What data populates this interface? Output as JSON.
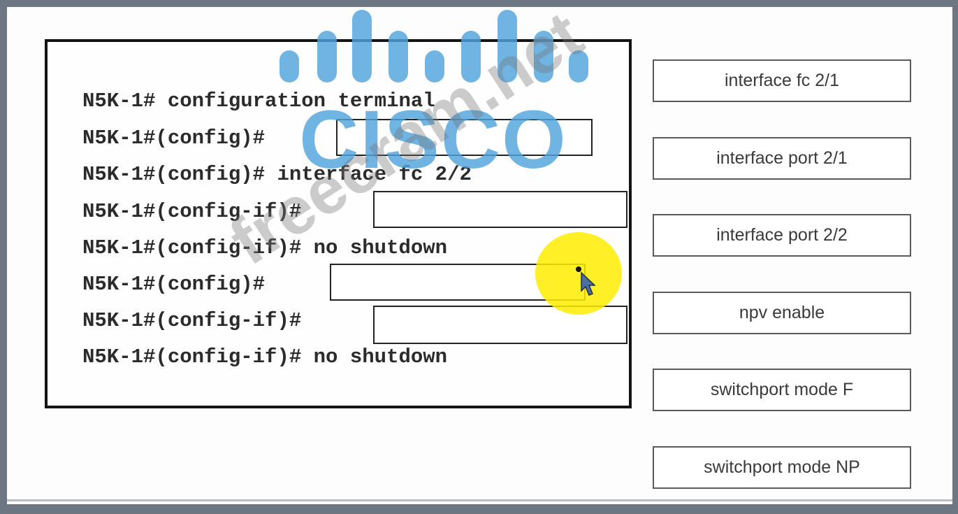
{
  "cli": {
    "lines": [
      "N5K-1# configuration terminal",
      "N5K-1#(config)#",
      "N5K-1#(config)# interface fc 2/2",
      "N5K-1#(config-if)#",
      "N5K-1#(config-if)# no shutdown",
      "N5K-1#(config)#",
      "N5K-1#(config-if)#",
      "N5K-1#(config-if)# no shutdown"
    ]
  },
  "options": [
    "interface fc 2/1",
    "interface port 2/1",
    "interface port 2/2",
    "npv enable",
    "switchport mode F",
    "switchport mode NP"
  ],
  "watermark": {
    "logo": "CISCO",
    "site": "freecram.net"
  },
  "colors": {
    "frame": "#6d7784",
    "logo_blue": "#4fa3dc",
    "highlight": "#ffec00"
  },
  "icons": {
    "cursor": "pointer-arrow-icon"
  }
}
